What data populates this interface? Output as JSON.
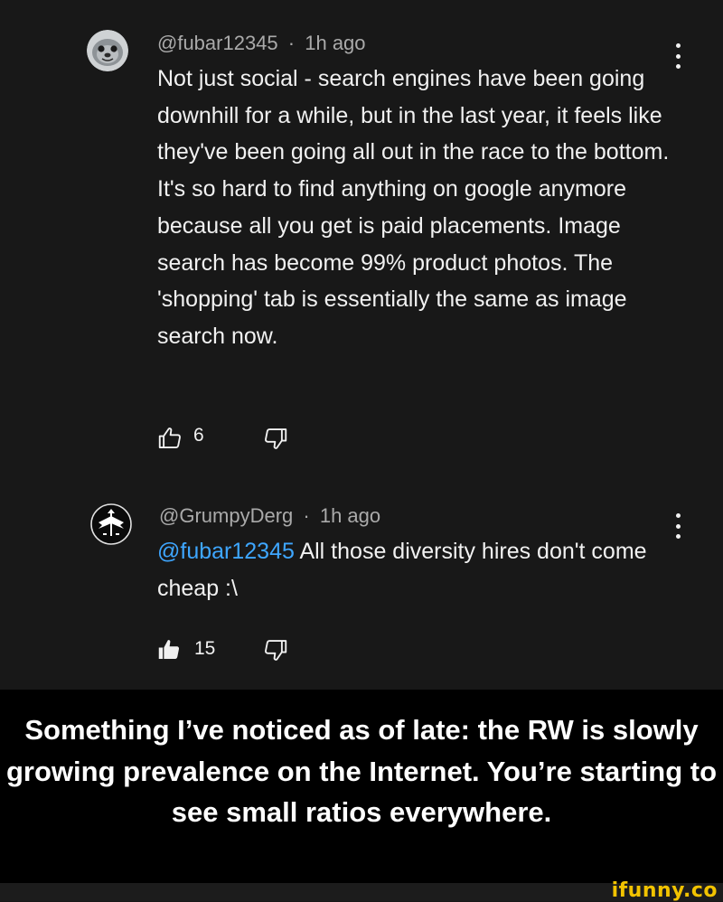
{
  "comments": [
    {
      "username": "@fubar12345",
      "time": "1h ago",
      "text": "Not just social - search engines have been going downhill for a while, but in the last year, it feels like they've been going all out in the race to the bottom. It's so hard to find anything on google anymore because all you get is paid placements. Image search has become 99% product photos. The 'shopping' tab is essentially the same as image search now.",
      "likes": "6",
      "liked": false,
      "avatar_icon": "seal-avatar-icon"
    },
    {
      "username": "@GrumpyDerg",
      "time": "1h ago",
      "mention": "@fubar12345",
      "text": " All those diversity hires don't come cheap :\\",
      "likes": "15",
      "liked": true,
      "avatar_icon": "dragon-emblem-avatar-icon"
    }
  ],
  "meta_separator": "·",
  "caption": "Something I’ve noticed as of late: the RW is slowly growing prevalence on the Internet. You’re starting to see small ratios everywhere.",
  "watermark": "ifunny.co",
  "colors": {
    "background": "#181818",
    "text": "#f1f1f1",
    "meta": "#aaaaaa",
    "mention": "#3ea6ff",
    "caption_bg": "#000000",
    "watermark": "#f2c300"
  }
}
